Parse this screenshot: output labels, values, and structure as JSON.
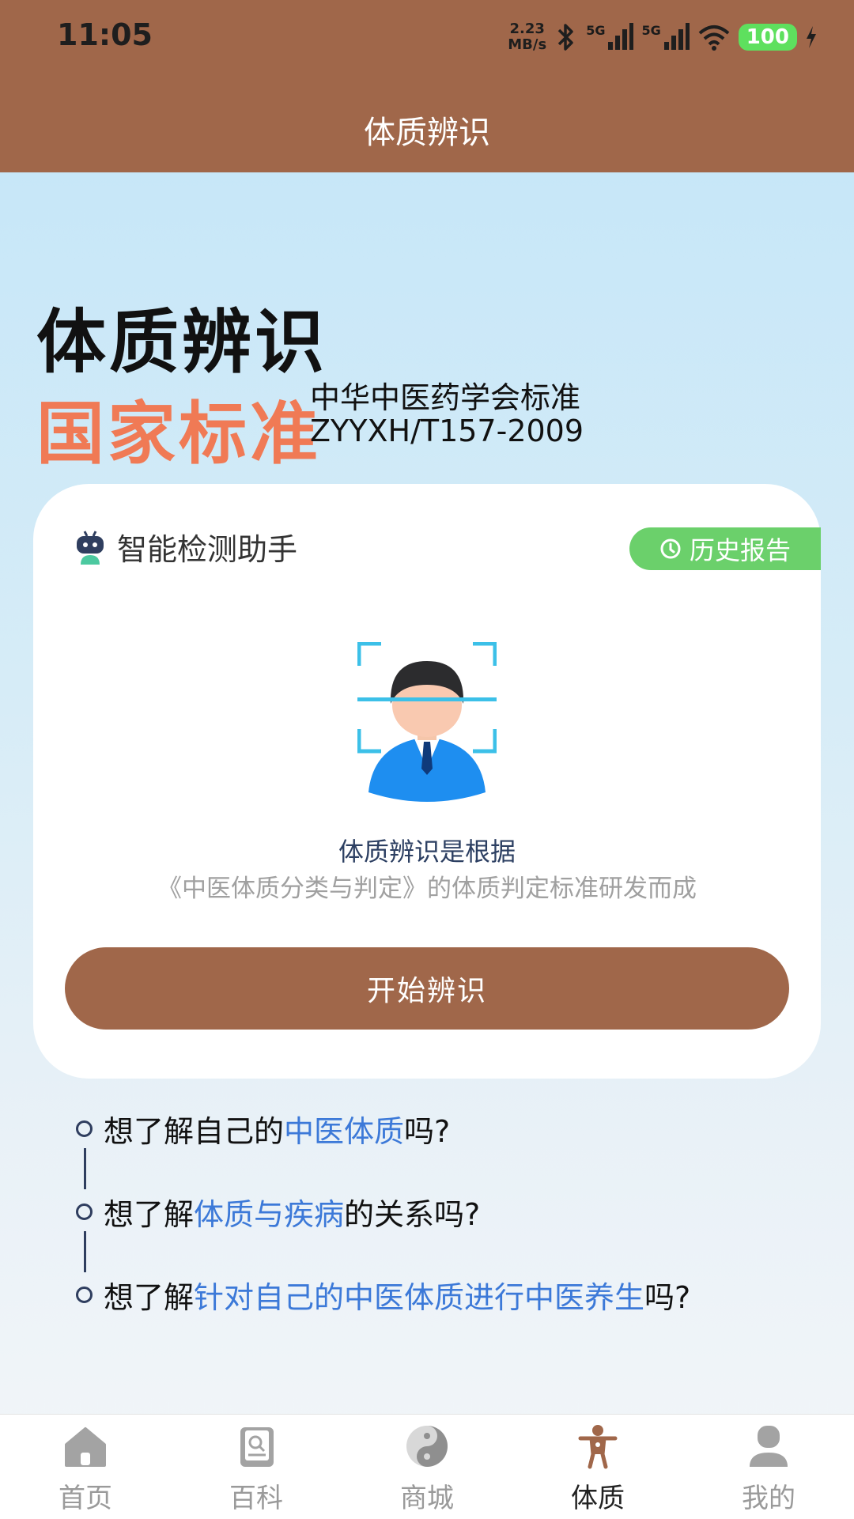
{
  "status": {
    "time": "11:05",
    "net_speed_value": "2.23",
    "net_speed_unit": "MB/s",
    "network1": "5G",
    "network2": "5G",
    "battery": "100"
  },
  "header": {
    "title": "体质辨识"
  },
  "hero": {
    "title": "体质辨识",
    "standard": "国家标准",
    "org": "中华中医药学会标准",
    "code": "ZYYXH/T157-2009"
  },
  "card": {
    "assistant_label": "智能检测助手",
    "history_label": "历史报告",
    "desc_main": "体质辨识是根据",
    "desc_sub": "《中医体质分类与判定》的体质判定标准研发而成",
    "start_label": "开始辨识"
  },
  "questions": [
    {
      "prefix": "想了解自己的",
      "highlight": "中医体质",
      "suffix": "吗?"
    },
    {
      "prefix": "想了解",
      "highlight": "体质与疾病",
      "suffix": "的关系吗?"
    },
    {
      "prefix": "想了解",
      "highlight": "针对自己的中医体质进行中医养生",
      "suffix": "吗?"
    }
  ],
  "tabs": [
    {
      "label": "首页",
      "icon": "home-icon"
    },
    {
      "label": "百科",
      "icon": "book-icon"
    },
    {
      "label": "商城",
      "icon": "yin-yang-icon"
    },
    {
      "label": "体质",
      "icon": "body-icon"
    },
    {
      "label": "我的",
      "icon": "profile-icon"
    }
  ],
  "colors": {
    "brand": "#a0674a",
    "accent_orange": "#f07a55",
    "highlight_blue": "#3c79d8",
    "history_green": "#6bd06b"
  }
}
